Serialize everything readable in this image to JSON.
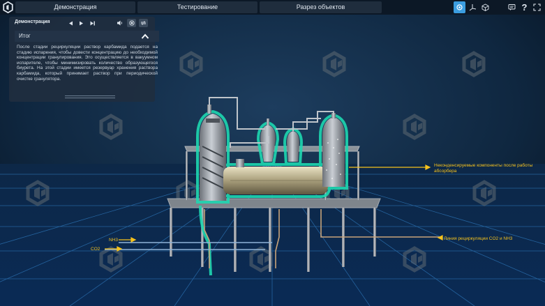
{
  "topbar": {
    "tabs": [
      {
        "label": "Демонстрация"
      },
      {
        "label": "Тестирование"
      },
      {
        "label": "Разрез объектов"
      }
    ],
    "right_icons": [
      "view-icon",
      "axes-icon",
      "cube-icon",
      "chat-icon",
      "help-icon",
      "fullscreen-icon"
    ]
  },
  "panel": {
    "title": "Демонстрация",
    "section_title": "Итог",
    "text": "После стадии рециркуляции раствор карбамида подается на стадию испарения, чтобы довести концентрацию до необходимой концентрации гранулирования. Это осуществляется в вакуумном испарителе, чтобы минимизировать количество образующегося биурета. На этой стадии имеется резервуар хранения раствора карбамида, который принимает раствор при периодической очистке гранулятора."
  },
  "scene": {
    "labels": {
      "uncondensed": "Неконденсируемые компоненты после работы абсорбера",
      "recirc_line": "Линия рециркуляции CO2 и NH3",
      "nh3": "NH3",
      "co2": "CO2"
    },
    "colors": {
      "highlight": "#1fd7b1",
      "label": "#f6c21c",
      "grid": "#2d76b8",
      "accent": "#3b9de0"
    }
  }
}
